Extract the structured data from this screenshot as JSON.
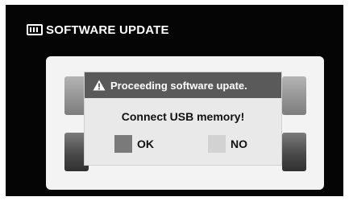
{
  "header": {
    "title": "SOFTWARE UPDATE",
    "icon": "keyboard-icon"
  },
  "dialog": {
    "title": "Proceeding software upate.",
    "title_icon": "warning-icon",
    "message": "Connect USB memory!",
    "ok_label": "OK",
    "no_label": "NO"
  },
  "colors": {
    "screen_bg": "#050505",
    "panel_bg": "#f3f3f3",
    "dialog_title_bg": "#5a5a5a",
    "ok_square": "#7a7a7a",
    "no_square": "#d2d2d2"
  }
}
